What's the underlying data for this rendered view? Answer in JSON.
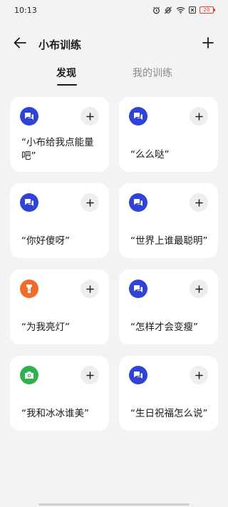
{
  "status_bar": {
    "time": "10:13",
    "battery": "20"
  },
  "header": {
    "title": "小布训练",
    "back_icon": "arrow-left-icon",
    "add_icon": "plus-icon"
  },
  "tabs": [
    {
      "label": "发现",
      "active": true
    },
    {
      "label": "我的训练",
      "active": false
    }
  ],
  "colors": {
    "chat_icon_bg": "#2f44d6",
    "flashlight_icon_bg": "#f26b2a",
    "camera_icon_bg": "#2eb24f"
  },
  "cards": [
    {
      "text": "“小布给我点能量吧”",
      "icon": "chat-icon"
    },
    {
      "text": "“么么哒”",
      "icon": "chat-icon"
    },
    {
      "text": "“你好傻呀”",
      "icon": "chat-icon"
    },
    {
      "text": "“世界上谁最聪明”",
      "icon": "chat-icon"
    },
    {
      "text": "“为我亮灯”",
      "icon": "flashlight-icon"
    },
    {
      "text": "“怎样才会变瘦”",
      "icon": "chat-icon"
    },
    {
      "text": "“我和冰冰谁美”",
      "icon": "camera-icon"
    },
    {
      "text": "“生日祝福怎么说”",
      "icon": "chat-icon"
    }
  ]
}
